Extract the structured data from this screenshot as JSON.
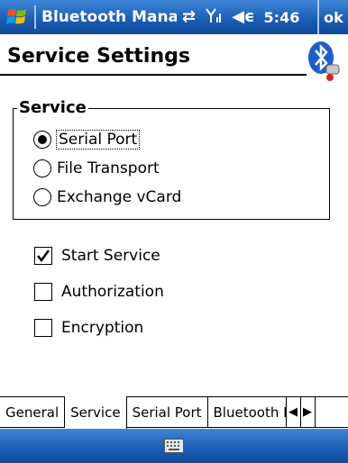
{
  "titlebar": {
    "title": "Bluetooth Mana",
    "time": "5:46",
    "ok_label": "ok"
  },
  "header": {
    "title": "Service Settings"
  },
  "service_group": {
    "label": "Service",
    "options": [
      {
        "label": "Serial Port",
        "selected": true
      },
      {
        "label": "File Transport",
        "selected": false
      },
      {
        "label": "Exchange vCard",
        "selected": false
      }
    ]
  },
  "checkboxes": [
    {
      "label": "Start Service",
      "checked": true
    },
    {
      "label": "Authorization",
      "checked": false
    },
    {
      "label": "Encryption",
      "checked": false
    }
  ],
  "tabs": [
    {
      "label": "General",
      "active": false
    },
    {
      "label": "Service",
      "active": true
    },
    {
      "label": "Serial Port",
      "active": false
    },
    {
      "label": "Bluetooth H",
      "active": false
    }
  ],
  "colors": {
    "titlebar_blue": "#1b5fb6",
    "bluetooth_blue": "#1d5fc9"
  }
}
